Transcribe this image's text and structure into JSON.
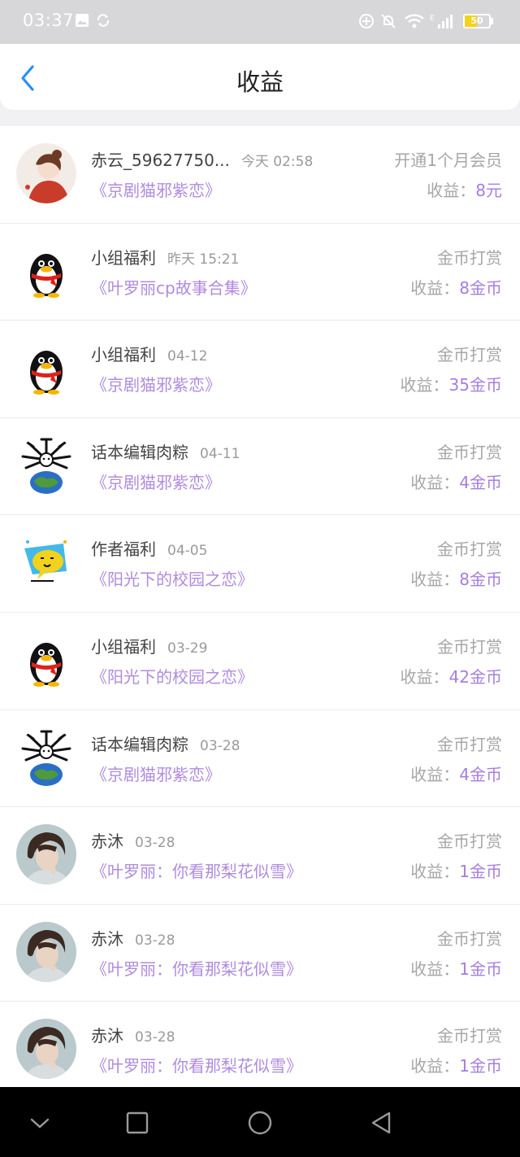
{
  "status_bar": {
    "time": "03:37",
    "battery": "50",
    "network_label": "E",
    "icons": [
      "image-icon",
      "sync-icon",
      "add-circle-icon",
      "mute-bell-icon",
      "wifi-icon",
      "signal-icon",
      "battery-icon"
    ]
  },
  "header": {
    "title": "收益",
    "back_icon": "chevron-left-icon",
    "accent_color": "#2a8ff7"
  },
  "colors": {
    "work_title": "#b08bde",
    "income_value": "#a57ee0",
    "muted": "#a6a6a6"
  },
  "rows": [
    {
      "name": "赤云_59627750...",
      "time": "今天 02:58",
      "work": "《京剧猫邪紫恋》",
      "type": "开通1个月会员",
      "income_label": "收益：",
      "income_value": "8元",
      "avatar": "girl-avatar"
    },
    {
      "name": "小组福利",
      "time": "昨天 15:21",
      "work": "《叶罗丽cp故事合集》",
      "type": "金币打赏",
      "income_label": "收益：",
      "income_value": "8金币",
      "avatar": "penguin-avatar"
    },
    {
      "name": "小组福利",
      "time": "04-12",
      "work": "《京剧猫邪紫恋》",
      "type": "金币打赏",
      "income_label": "收益：",
      "income_value": "35金币",
      "avatar": "penguin-avatar"
    },
    {
      "name": "话本编辑肉粽",
      "time": "04-11",
      "work": "《京剧猫邪紫恋》",
      "type": "金币打赏",
      "income_label": "收益：",
      "income_value": "4金币",
      "avatar": "globe-avatar"
    },
    {
      "name": "作者福利",
      "time": "04-05",
      "work": "《阳光下的校园之恋》",
      "type": "金币打赏",
      "income_label": "收益：",
      "income_value": "8金币",
      "avatar": "chat-bubble-avatar"
    },
    {
      "name": "小组福利",
      "time": "03-29",
      "work": "《阳光下的校园之恋》",
      "type": "金币打赏",
      "income_label": "收益：",
      "income_value": "42金币",
      "avatar": "penguin-avatar"
    },
    {
      "name": "话本编辑肉粽",
      "time": "03-28",
      "work": "《京剧猫邪紫恋》",
      "type": "金币打赏",
      "income_label": "收益：",
      "income_value": "4金币",
      "avatar": "globe-avatar"
    },
    {
      "name": "赤沐",
      "time": "03-28",
      "work": "《叶罗丽：你看那梨花似雪》",
      "type": "金币打赏",
      "income_label": "收益：",
      "income_value": "1金币",
      "avatar": "boy-avatar"
    },
    {
      "name": "赤沐",
      "time": "03-28",
      "work": "《叶罗丽：你看那梨花似雪》",
      "type": "金币打赏",
      "income_label": "收益：",
      "income_value": "1金币",
      "avatar": "boy-avatar"
    },
    {
      "name": "赤沐",
      "time": "03-28",
      "work": "《叶罗丽：你看那梨花似雪》",
      "type": "金币打赏",
      "income_label": "收益：",
      "income_value": "1金币",
      "avatar": "boy-avatar"
    }
  ],
  "nav_bar": {
    "buttons": [
      "chevron-down-icon",
      "recents-square-icon",
      "home-circle-icon",
      "back-triangle-icon"
    ]
  }
}
